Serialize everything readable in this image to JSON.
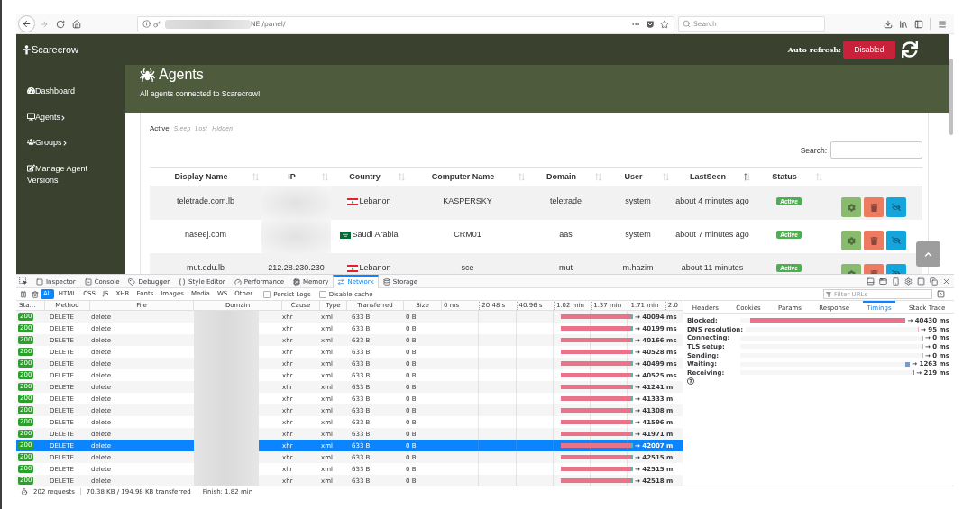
{
  "browser": {
    "url": "NEI/panel/",
    "url_redacted": true,
    "search": {
      "placeholder": "Search"
    }
  },
  "navbar": {
    "brand": "Scarecrow",
    "auto_refresh_label": "Auto refresh:",
    "auto_refresh_button": "Disabled"
  },
  "sidebar": {
    "items": [
      {
        "label": "Dashboard",
        "submenu": false
      },
      {
        "label": "Agents",
        "submenu": true
      },
      {
        "label": "Groups",
        "submenu": true
      },
      {
        "label": "Manage Agent Versions",
        "submenu": false
      }
    ]
  },
  "banner": {
    "title": "Agents",
    "subtitle": "All agents connected to Scarecrow!"
  },
  "agent_tabs": [
    {
      "label": "Active",
      "selected": true
    },
    {
      "label": "Sleep",
      "selected": false
    },
    {
      "label": "Lost",
      "selected": false
    },
    {
      "label": "Hidden",
      "selected": false
    }
  ],
  "search": {
    "label": "Search:"
  },
  "table": {
    "columns": [
      {
        "label": "Display Name",
        "sorted": false
      },
      {
        "label": "IP",
        "sorted": false
      },
      {
        "label": "Country",
        "sorted": false
      },
      {
        "label": "Computer Name",
        "sorted": false
      },
      {
        "label": "Domain",
        "sorted": false
      },
      {
        "label": "User",
        "sorted": false
      },
      {
        "label": "LastSeen",
        "sorted": true
      },
      {
        "label": "Status",
        "sorted": false
      }
    ],
    "rows": [
      {
        "display_name": "teletrade.com.lb",
        "ip_redacted": true,
        "kind": "lb",
        "country": "Lebanon",
        "computer_name": "KASPERSKY",
        "domain": "teletrade",
        "user": "system",
        "last_seen": "about 4 minutes ago",
        "status": "Active"
      },
      {
        "display_name": "naseej.com",
        "ip_redacted": true,
        "kind": "sa",
        "country": "Saudi Arabia",
        "computer_name": "CRM01",
        "domain": "aas",
        "user": "system",
        "last_seen": "about 7 minutes ago",
        "status": "Active"
      },
      {
        "display_name": "mut.edu.lb",
        "ip_redacted": false,
        "ip": "212.28.230.230",
        "kind": "lb",
        "country": "Lebanon",
        "computer_name": "sce",
        "domain": "mut",
        "user": "m.hazim",
        "last_seen": "about 11 minutes",
        "status": "Active"
      }
    ]
  },
  "devtools": {
    "tabs": [
      {
        "label": "Inspector",
        "selected": false
      },
      {
        "label": "Console",
        "selected": false
      },
      {
        "label": "Debugger",
        "selected": false
      },
      {
        "label": "Style Editor",
        "selected": false
      },
      {
        "label": "Performance",
        "selected": false
      },
      {
        "label": "Memory",
        "selected": false
      },
      {
        "label": "Network",
        "selected": true
      },
      {
        "label": "Storage",
        "selected": false
      }
    ],
    "filters": [
      {
        "label": "All",
        "selected": true
      },
      {
        "label": "HTML",
        "selected": false
      },
      {
        "label": "CSS",
        "selected": false
      },
      {
        "label": "JS",
        "selected": false
      },
      {
        "label": "XHR",
        "selected": false
      },
      {
        "label": "Fonts",
        "selected": false
      },
      {
        "label": "Images",
        "selected": false
      },
      {
        "label": "Media",
        "selected": false
      },
      {
        "label": "WS",
        "selected": false
      },
      {
        "label": "Other",
        "selected": false
      }
    ],
    "options": [
      {
        "label": "Persist Logs",
        "checked": false
      },
      {
        "label": "Disable cache",
        "checked": false
      }
    ],
    "filter_field": {
      "placeholder": "Filter URLs"
    },
    "columns": [
      "Sta…",
      "Method",
      "File",
      "Domain",
      "Cause",
      "Type",
      "Transferred",
      "Size"
    ],
    "timeline_ticks": [
      "0 ms",
      "20.48 s",
      "40.96 s",
      "1.02 min",
      "1.37 min",
      "1.71 min",
      "2.0"
    ],
    "requests": [
      {
        "status": "200",
        "method": "DELETE",
        "file": "delete",
        "domain_redacted": true,
        "cause": "xhr",
        "type": "xml",
        "transferred": "633 B",
        "size": "0 B",
        "duration": "→ 40094 ms",
        "selected": false
      },
      {
        "status": "200",
        "method": "DELETE",
        "file": "delete",
        "domain_redacted": true,
        "cause": "xhr",
        "type": "xml",
        "transferred": "633 B",
        "size": "0 B",
        "duration": "→ 40199 ms",
        "selected": false
      },
      {
        "status": "200",
        "method": "DELETE",
        "file": "delete",
        "domain_redacted": true,
        "cause": "xhr",
        "type": "xml",
        "transferred": "633 B",
        "size": "0 B",
        "duration": "→ 40166 ms",
        "selected": false
      },
      {
        "status": "200",
        "method": "DELETE",
        "file": "delete",
        "domain_redacted": true,
        "cause": "xhr",
        "type": "xml",
        "transferred": "633 B",
        "size": "0 B",
        "duration": "→ 40528 ms",
        "selected": false
      },
      {
        "status": "200",
        "method": "DELETE",
        "file": "delete",
        "domain_redacted": true,
        "cause": "xhr",
        "type": "xml",
        "transferred": "633 B",
        "size": "0 B",
        "duration": "→ 40499 ms",
        "selected": false
      },
      {
        "status": "200",
        "method": "DELETE",
        "file": "delete",
        "domain_redacted": true,
        "cause": "xhr",
        "type": "xml",
        "transferred": "633 B",
        "size": "0 B",
        "duration": "→ 40525 ms",
        "selected": false
      },
      {
        "status": "200",
        "method": "DELETE",
        "file": "delete",
        "domain_redacted": true,
        "cause": "xhr",
        "type": "xml",
        "transferred": "633 B",
        "size": "0 B",
        "duration": "→ 41241 m",
        "selected": false
      },
      {
        "status": "200",
        "method": "DELETE",
        "file": "delete",
        "domain_redacted": true,
        "cause": "xhr",
        "type": "xml",
        "transferred": "633 B",
        "size": "0 B",
        "duration": "→ 41333 m",
        "selected": false
      },
      {
        "status": "200",
        "method": "DELETE",
        "file": "delete",
        "domain_redacted": true,
        "cause": "xhr",
        "type": "xml",
        "transferred": "633 B",
        "size": "0 B",
        "duration": "→ 41308 m",
        "selected": false
      },
      {
        "status": "200",
        "method": "DELETE",
        "file": "delete",
        "domain_redacted": true,
        "cause": "xhr",
        "type": "xml",
        "transferred": "633 B",
        "size": "0 B",
        "duration": "→ 41596 m",
        "selected": false
      },
      {
        "status": "200",
        "method": "DELETE",
        "file": "delete",
        "domain_redacted": true,
        "cause": "xhr",
        "type": "xml",
        "transferred": "633 B",
        "size": "0 B",
        "duration": "→ 41971 m",
        "selected": false
      },
      {
        "status": "200",
        "method": "DELETE",
        "file": "delete",
        "domain_redacted": true,
        "cause": "xhr",
        "type": "xml",
        "transferred": "633 B",
        "size": "0 B",
        "duration": "→ 42007 m",
        "selected": true
      },
      {
        "status": "200",
        "method": "DELETE",
        "file": "delete",
        "domain_redacted": true,
        "cause": "xhr",
        "type": "xml",
        "transferred": "633 B",
        "size": "0 B",
        "duration": "→ 42515 m",
        "selected": false
      },
      {
        "status": "200",
        "method": "DELETE",
        "file": "delete",
        "domain_redacted": true,
        "cause": "xhr",
        "type": "xml",
        "transferred": "633 B",
        "size": "0 B",
        "duration": "→ 42515 m",
        "selected": false
      },
      {
        "status": "200",
        "method": "DELETE",
        "file": "delete",
        "domain_redacted": true,
        "cause": "xhr",
        "type": "xml",
        "transferred": "633 B",
        "size": "0 B",
        "duration": "→ 42518 m",
        "selected": false
      }
    ],
    "summary": [
      "202 requests",
      "70.38 KB / 194.98 KB transferred",
      "Finish: 1.82 min"
    ],
    "detail_tabs": [
      {
        "label": "Headers",
        "selected": false
      },
      {
        "label": "Cookies",
        "selected": false
      },
      {
        "label": "Params",
        "selected": false
      },
      {
        "label": "Response",
        "selected": false
      },
      {
        "label": "Timings",
        "selected": true
      },
      {
        "label": "Stack Trace",
        "selected": false
      }
    ],
    "timings": [
      {
        "label": "Blocked:",
        "value": "→ 40430 ms",
        "level": 0.94,
        "color": "#e8738a"
      },
      {
        "label": "DNS resolution:",
        "value": "→ 95 ms",
        "level": 0.006,
        "color": "#f4a9b8"
      },
      {
        "label": "Connecting:",
        "value": "→ 0 ms",
        "level": 0.006,
        "color": "#f19c8c"
      },
      {
        "label": "TLS setup:",
        "value": "→ 0 ms",
        "level": 0.006,
        "color": "#f2b07e"
      },
      {
        "label": "Sending:",
        "value": "→ 0 ms",
        "level": 0.006,
        "color": "#a3c6ee"
      },
      {
        "label": "Waiting:",
        "value": "→ 1263 ms",
        "level": 0.03,
        "color": "#7d9ac4"
      },
      {
        "label": "Receiving:",
        "value": "→ 219 ms",
        "level": 0.006,
        "color": "#45b34f"
      }
    ]
  }
}
